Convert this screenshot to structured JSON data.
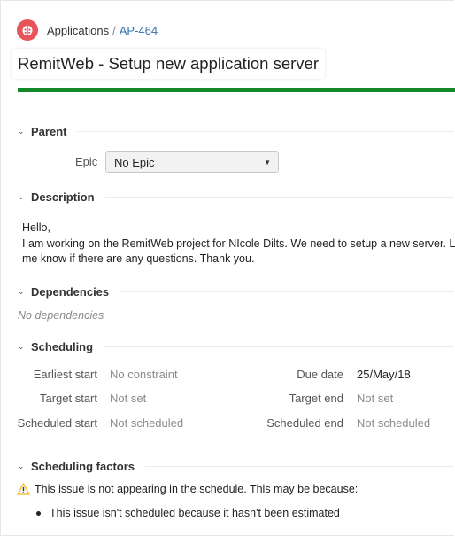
{
  "breadcrumb": {
    "project_logo_icon": "ladybug-icon",
    "parent": "Applications",
    "separator": "/",
    "issue_key": "AP-464"
  },
  "issue": {
    "title": "RemitWeb - Setup new application server",
    "progress_percent": 100,
    "progress_color": "#14892c"
  },
  "sections": {
    "parent": {
      "heading": "Parent",
      "epic_label": "Epic",
      "epic_value": "No Epic"
    },
    "description": {
      "heading": "Description",
      "lines": [
        "Hello,",
        "I am working on the RemitWeb project for NIcole Dilts.  We need to setup a new server.  Let",
        "me know if there are any questions.  Thank you."
      ]
    },
    "dependencies": {
      "heading": "Dependencies",
      "empty_text": "No dependencies"
    },
    "scheduling": {
      "heading": "Scheduling",
      "left": [
        {
          "label": "Earliest start",
          "value": "No constraint"
        },
        {
          "label": "Target start",
          "value": "Not set"
        },
        {
          "label": "Scheduled start",
          "value": "Not scheduled"
        }
      ],
      "right": [
        {
          "label": "Due date",
          "value": "25/May/18"
        },
        {
          "label": "Target end",
          "value": "Not set"
        },
        {
          "label": "Scheduled end",
          "value": "Not scheduled"
        }
      ]
    },
    "scheduling_factors": {
      "heading": "Scheduling factors",
      "warning": "This issue is not appearing in the schedule. This may be because:",
      "warning_color": "#f6c342",
      "reasons": [
        "This issue isn't scheduled because it hasn't been estimated"
      ]
    }
  }
}
